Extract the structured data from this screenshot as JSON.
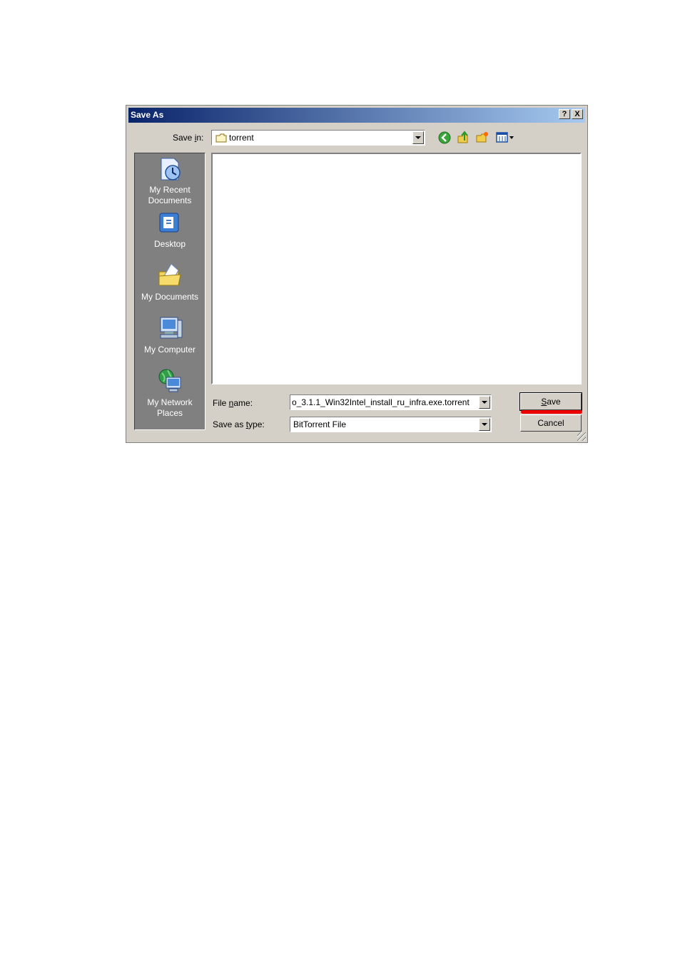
{
  "dialog": {
    "title": "Save As",
    "help_button": "?",
    "close_button": "X"
  },
  "save_in": {
    "label_prefix": "Save ",
    "label_underlined": "i",
    "label_suffix": "n:",
    "value": "torrent"
  },
  "places": [
    {
      "label_line1": "My Recent",
      "label_line2": "Documents",
      "icon": "recent-documents-icon"
    },
    {
      "label_line1": "Desktop",
      "label_line2": "",
      "icon": "desktop-icon"
    },
    {
      "label_line1": "My Documents",
      "label_line2": "",
      "icon": "my-documents-icon"
    },
    {
      "label_line1": "My Computer",
      "label_line2": "",
      "icon": "my-computer-icon"
    },
    {
      "label_line1": "My Network",
      "label_line2": "Places",
      "icon": "network-places-icon"
    }
  ],
  "file_name": {
    "label_prefix": "File ",
    "label_underlined": "n",
    "label_suffix": "ame:",
    "value": "o_3.1.1_Win32Intel_install_ru_infra.exe.torrent"
  },
  "save_as_type": {
    "label_prefix": "Save as ",
    "label_underlined": "t",
    "label_suffix": "ype:",
    "value": "BitTorrent File"
  },
  "buttons": {
    "save_underlined": "S",
    "save_rest": "ave",
    "cancel": "Cancel"
  },
  "colors": {
    "title_gradient_start": "#0a246a",
    "title_gradient_end": "#a6caf0",
    "dialog_face": "#d4d0c8",
    "places_bar": "#808080",
    "annotation_mark": "#ee0000"
  }
}
